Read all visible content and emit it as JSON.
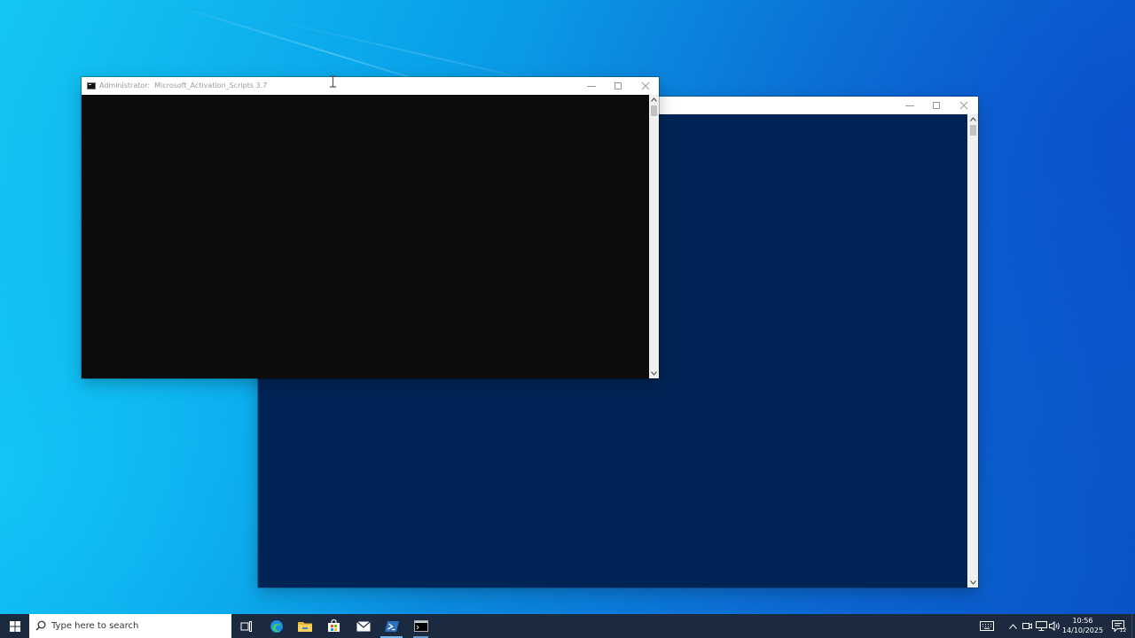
{
  "cmd_window": {
    "title_prefix": "Administrator:",
    "title_name": "Microsoft_Activation_Scripts 3.7",
    "bg_color": "#0c0c0c"
  },
  "ps_window": {
    "title": "",
    "bg_color": "#012456"
  },
  "window_controls": {
    "minimize_icon": "minimize-icon",
    "maximize_icon": "maximize-icon",
    "close_icon": "close-icon"
  },
  "taskbar": {
    "start_icon": "windows-logo-icon",
    "search_placeholder": "Type here to search",
    "pinned": [
      {
        "name": "task-view-icon"
      },
      {
        "name": "edge-icon"
      },
      {
        "name": "file-explorer-icon"
      },
      {
        "name": "microsoft-store-icon"
      },
      {
        "name": "mail-icon"
      },
      {
        "name": "powershell-icon"
      },
      {
        "name": "command-prompt-icon"
      }
    ],
    "tray": {
      "icons": [
        "keyboard-icon",
        "chevron-up-icon",
        "meet-now-icon",
        "network-icon",
        "volume-icon"
      ],
      "time": "10:56",
      "date": "14/10/2025",
      "notification_count": "12"
    }
  },
  "colors": {
    "taskbar_bg": "#1b2a3e",
    "accent": "#76b9ed"
  }
}
